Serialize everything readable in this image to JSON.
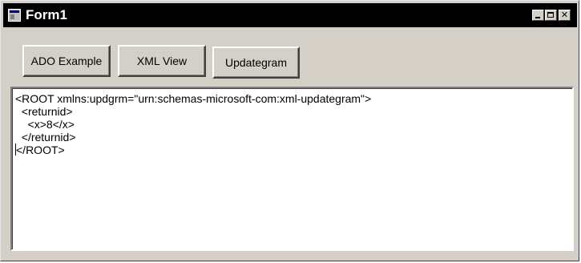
{
  "window": {
    "title": "Form1",
    "controls": {
      "minimize_icon": "minimize-icon",
      "maximize_icon": "maximize-icon",
      "close_icon": "close-icon",
      "close_glyph": "✕"
    }
  },
  "toolbar": {
    "buttons": [
      {
        "label": "ADO Example"
      },
      {
        "label": "XML View"
      },
      {
        "label": "Updategram"
      }
    ]
  },
  "editor": {
    "lines": [
      "<ROOT xmlns:updgrm=\"urn:schemas-microsoft-com:xml-updategram\">",
      "  <returnid>",
      "    <x>8</x>",
      "  </returnid>",
      "</ROOT>"
    ]
  }
}
